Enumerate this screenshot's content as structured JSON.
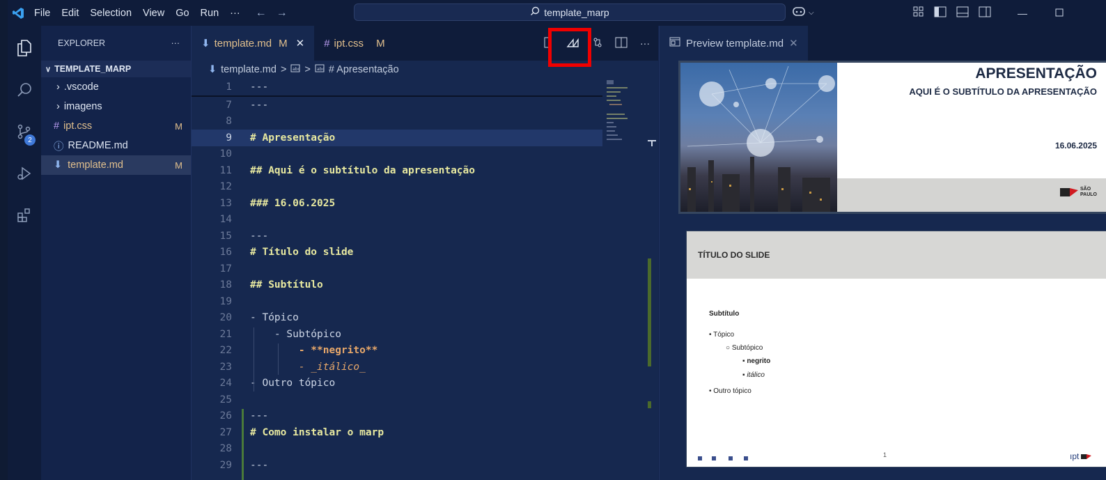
{
  "menu": {
    "items": [
      "File",
      "Edit",
      "Selection",
      "View",
      "Go",
      "Run",
      "···"
    ]
  },
  "command_center": {
    "text": "template_marp"
  },
  "explorer": {
    "title": "EXPLORER",
    "more": "···",
    "root": "TEMPLATE_MARP",
    "items": [
      {
        "label": ".vscode",
        "git": ""
      },
      {
        "label": "imagens",
        "git": ""
      },
      {
        "label": "ipt.css",
        "git": "M"
      },
      {
        "label": "README.md",
        "git": ""
      },
      {
        "label": "template.md",
        "git": "M"
      }
    ]
  },
  "scm_badge": "2",
  "tabs": [
    {
      "label": "template.md",
      "mod": "M",
      "close": "✕"
    },
    {
      "label": "ipt.css",
      "mod": "M"
    }
  ],
  "breadcrumb": {
    "file": "template.md",
    "sep": ">",
    "symbol": "# Apresentação"
  },
  "code_lines": [
    {
      "n": "1",
      "text": "---"
    },
    {
      "n": "7",
      "text": "---"
    },
    {
      "n": "8",
      "text": ""
    },
    {
      "n": "9",
      "text": "# Apresentação"
    },
    {
      "n": "10",
      "text": ""
    },
    {
      "n": "11",
      "text": "## Aqui é o subtítulo da apresentação"
    },
    {
      "n": "12",
      "text": ""
    },
    {
      "n": "13",
      "text": "### 16.06.2025"
    },
    {
      "n": "14",
      "text": ""
    },
    {
      "n": "15",
      "text": "---"
    },
    {
      "n": "16",
      "text": "# Título do slide"
    },
    {
      "n": "17",
      "text": ""
    },
    {
      "n": "18",
      "text": "## Subtítulo"
    },
    {
      "n": "19",
      "text": ""
    },
    {
      "n": "20",
      "text": "- Tópico"
    },
    {
      "n": "21",
      "text": "    - Subtópico"
    },
    {
      "n": "22",
      "text": "        - **negrito**"
    },
    {
      "n": "23",
      "text": "        - _itálico_"
    },
    {
      "n": "24",
      "text": "- Outro tópico"
    },
    {
      "n": "25",
      "text": ""
    },
    {
      "n": "26",
      "text": "---"
    },
    {
      "n": "27",
      "text": "# Como instalar o marp"
    },
    {
      "n": "28",
      "text": ""
    },
    {
      "n": "29",
      "text": "---"
    }
  ],
  "preview": {
    "tab_label": "Preview template.md",
    "close": "✕",
    "slide1": {
      "title": "APRESENTAÇÃO",
      "subtitle": "AQUI É O SUBTÍTULO DA APRESENTAÇÃO",
      "date": "16.06.2025",
      "logo_text": "SÃO PAULO"
    },
    "slide2": {
      "title": "TÍTULO DO SLIDE",
      "subtitle": "Subtítulo",
      "bullet1": "• Tópico",
      "bullet1a": "○ Subtópico",
      "bullet1a1": "▪ negrito",
      "bullet1a2": "▪ itálico",
      "bullet2": "• Outro tópico",
      "page_number": "1",
      "footer_logo": "ıpt"
    }
  },
  "colors": {
    "accent_highlight": "#f00000",
    "background": "#13234a",
    "heading": "#e8e9a0",
    "modified": "#e2c08d"
  }
}
